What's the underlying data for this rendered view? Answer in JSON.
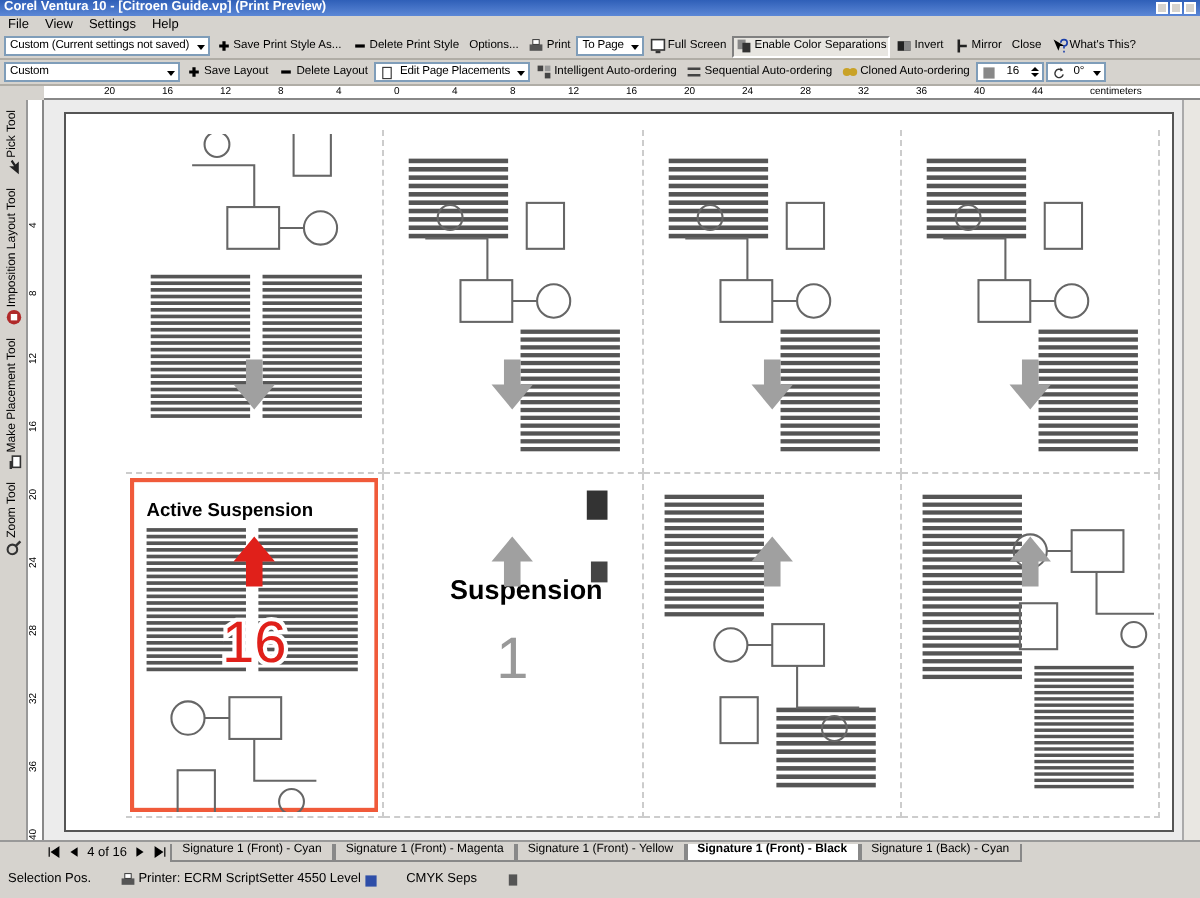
{
  "window": {
    "title": "Corel Ventura 10 - [Citroen Guide.vp] (Print Preview)"
  },
  "menu": [
    "File",
    "View",
    "Settings",
    "Help"
  ],
  "toolbar_1": [
    {
      "kind": "dropdown",
      "label": "Custom (Current settings not saved)"
    },
    {
      "kind": "button",
      "label": "Save Print Style As..."
    },
    {
      "kind": "button",
      "label": "Delete Print Style"
    },
    {
      "kind": "button",
      "label": "Options..."
    },
    {
      "kind": "button",
      "label": "Print"
    },
    {
      "kind": "dropdown",
      "label": "To Page"
    },
    {
      "kind": "button",
      "label": "Full Screen"
    },
    {
      "kind": "toggle",
      "label": "Enable Color Separations",
      "pressed": true
    },
    {
      "kind": "button",
      "label": "Invert"
    },
    {
      "kind": "button",
      "label": "Mirror"
    },
    {
      "kind": "button",
      "label": "Close"
    },
    {
      "kind": "button",
      "label": "What's This?"
    }
  ],
  "toolbar_2": [
    {
      "kind": "dropdown",
      "label": "Custom"
    },
    {
      "kind": "button",
      "label": "Save Layout"
    },
    {
      "kind": "button",
      "label": "Delete Layout"
    },
    {
      "kind": "dropdown",
      "label": "Edit Page Placements"
    },
    {
      "kind": "button",
      "label": "Intelligent Auto-ordering"
    },
    {
      "kind": "button",
      "label": "Sequential Auto-ordering"
    },
    {
      "kind": "button",
      "label": "Cloned Auto-ordering"
    },
    {
      "kind": "spinner",
      "label": "16"
    },
    {
      "kind": "dropdown",
      "label": "0°"
    }
  ],
  "ruler": {
    "labels": [
      "20",
      "16",
      "12",
      "8",
      "4",
      "0",
      "4",
      "8",
      "12",
      "16",
      "20",
      "24",
      "28",
      "32",
      "36",
      "40",
      "44"
    ],
    "unit": "centimeters"
  },
  "vertical_ruler": {
    "labels": [
      "4",
      "8",
      "12",
      "16",
      "20",
      "24",
      "28",
      "32",
      "36",
      "40"
    ]
  },
  "tools": [
    "Pick Tool",
    "Imposition Layout Tool",
    "Make Placement Tool",
    "Zoom Tool"
  ],
  "pages": [
    {
      "upside_down": true,
      "selected": false,
      "kind": "text"
    },
    {
      "upside_down": true,
      "selected": false,
      "kind": "diagram"
    },
    {
      "upside_down": true,
      "selected": false,
      "kind": "diagram"
    },
    {
      "upside_down": true,
      "selected": false,
      "kind": "diagram"
    },
    {
      "upside_down": false,
      "selected": true,
      "kind": "text",
      "heading": "Active Suspension",
      "number": "16"
    },
    {
      "upside_down": false,
      "selected": false,
      "kind": "title",
      "heading": "Suspension",
      "number": "1"
    },
    {
      "upside_down": false,
      "selected": false,
      "kind": "diagram"
    },
    {
      "upside_down": false,
      "selected": false,
      "kind": "table"
    }
  ],
  "page_counter": "4 of 16",
  "tabs": [
    {
      "label": "Signature 1 (Front) - Cyan",
      "selected": false
    },
    {
      "label": "Signature 1 (Front) - Magenta",
      "selected": false
    },
    {
      "label": "Signature 1 (Front) - Yellow",
      "selected": false
    },
    {
      "label": "Signature 1 (Front) - Black",
      "selected": true
    },
    {
      "label": "Signature 1 (Back) - Cyan",
      "selected": false
    }
  ],
  "status_bar": {
    "selection": "Selection Pos.",
    "printer": "Printer: ECRM ScriptSetter 4550 Level",
    "mode": "CMYK Seps"
  }
}
